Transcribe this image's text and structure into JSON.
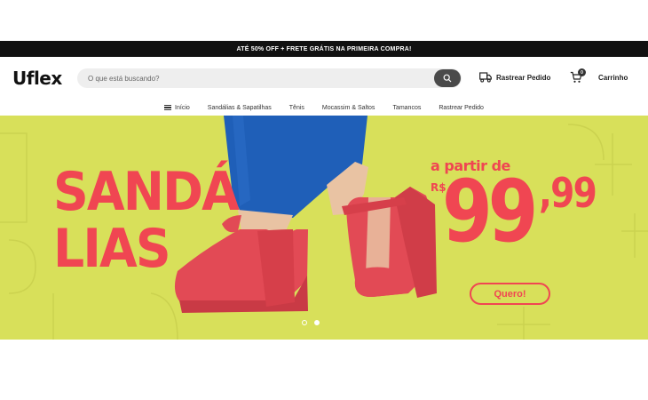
{
  "promo": {
    "text": "ATÉ 50% OFF + FRETE GRÁTIS NA PRIMEIRA COMPRA!"
  },
  "header": {
    "logo": "Uflex",
    "search_placeholder": "O que está buscando?",
    "track_label": "Rastrear Pedido",
    "cart_label": "Carrinho",
    "cart_count": "0"
  },
  "nav": {
    "items": [
      {
        "label": "Início"
      },
      {
        "label": "Sandálias & Sapatilhas"
      },
      {
        "label": "Tênis"
      },
      {
        "label": "Mocassim & Saltos"
      },
      {
        "label": "Tamancos"
      },
      {
        "label": "Rastrear Pedido"
      }
    ]
  },
  "banner": {
    "headline_1": "SANDÁ",
    "headline_2": "LIAS",
    "from_text": "a partir de",
    "currency": "R$",
    "price_int": "99",
    "price_dec": ",99",
    "cta": "Quero!",
    "background_color": "#d8e05a",
    "accent_color": "#f04652",
    "slides_total": 2,
    "active_slide": 2
  }
}
